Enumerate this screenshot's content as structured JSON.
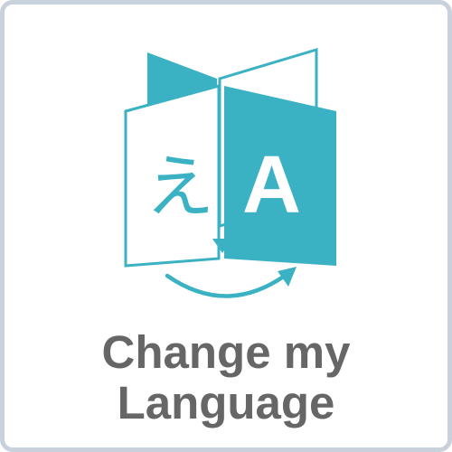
{
  "tile": {
    "label_line1": "Change my",
    "label_line2": "Language",
    "icon": "translate-book-icon"
  },
  "colors": {
    "accent": "#3ab2c4",
    "text": "#666666",
    "border": "#c9d1dc"
  }
}
